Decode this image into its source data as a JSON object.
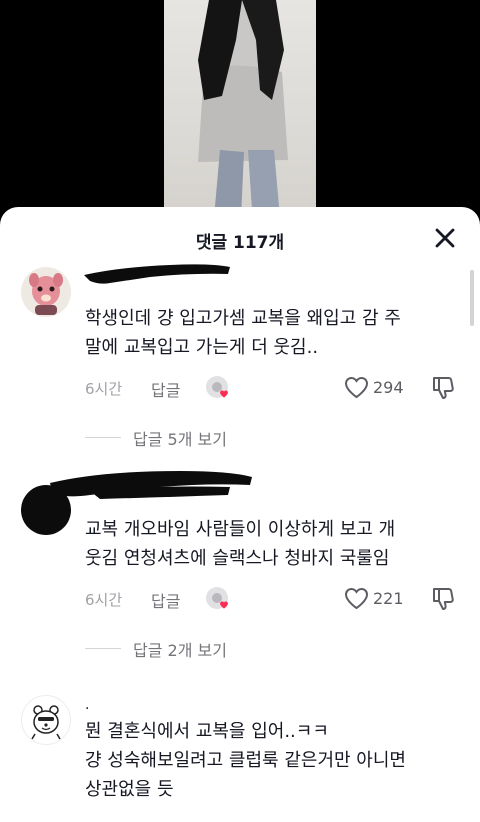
{
  "header": {
    "title": "댓글 117개"
  },
  "comments": [
    {
      "text": "학생인데 걍 입고가셈 교복을 왜입고 감 주\n말에 교복입고 가는게 더 웃김..",
      "time": "6시간",
      "reply_label": "답글",
      "likes": "294",
      "view_replies": "답글 5개 보기"
    },
    {
      "text": "교복 개오바임 사람들이 이상하게 보고 개\n웃김 연청셔츠에 슬랙스나 청바지 국룰임",
      "time": "6시간",
      "reply_label": "답글",
      "likes": "221",
      "view_replies": "답글 2개 보기"
    },
    {
      "username": ".",
      "text": "뭔 결혼식에서 교복을 입어..ㅋㅋ\n걍 성숙해보일려고 클럽룩 같은거만 아니면\n상관없을 듯"
    }
  ],
  "colors": {
    "accent_red": "#fe2c55",
    "text_primary": "#161823",
    "text_secondary": "#a1a2a7"
  }
}
